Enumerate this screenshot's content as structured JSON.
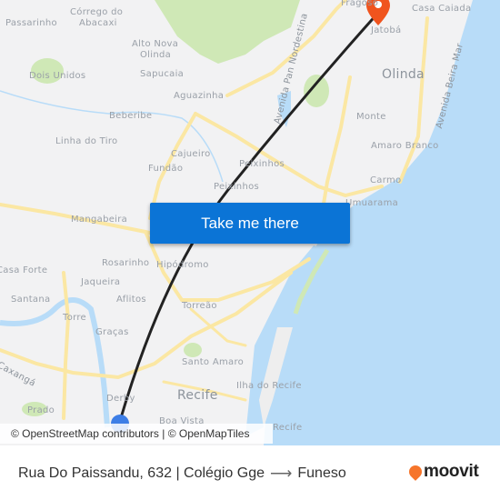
{
  "map": {
    "labels": {
      "passarinho": "Passarinho",
      "corrego": "Córrego do",
      "abacaxi": "Abacaxi",
      "alto_nova": "Alto Nova",
      "olinda_small": "Olinda",
      "dois_unidos": "Dois Unidos",
      "sapucaia": "Sapucaia",
      "aguazinha": "Aguazinha",
      "beberibe": "Beberibe",
      "linha_do_tiro": "Linha do Tiro",
      "cajueiro": "Cajueiro",
      "fundao": "Fundão",
      "peixinhos1": "Peixinhos",
      "peixinhos2": "Peixinhos",
      "fragoso": "Fragoso",
      "casa_caiada": "Casa Caiada",
      "jatoba": "Jatobá",
      "olinda": "Olinda",
      "monte": "Monte",
      "amaro_branco": "Amaro Branco",
      "carmo": "Carmo",
      "umuarama": "Umuarama",
      "av_pan_nordestina": "Avenida Pan Nordestina",
      "av_beira_mar": "Avenida Beira Mar",
      "mangabeira": "Mangabeira",
      "casa_forte": "Casa Forte",
      "rosarinho": "Rosarinho",
      "hipodromo": "Hipódromo",
      "jaqueira": "Jaqueira",
      "santana": "Santana",
      "aflitos": "Aflitos",
      "torreao": "Torreão",
      "torre": "Torre",
      "gracas": "Graças",
      "av_caxanga": "Avenida Caxangá",
      "santo_amaro": "Santo Amaro",
      "recife": "Recife",
      "ilha_do_recife": "Ilha do Recife",
      "derby": "Derby",
      "prado": "Prado",
      "boa_vista": "Boa Vista",
      "recife_antigo": "Recife"
    },
    "cta_label": "Take me there",
    "attribution": "© OpenStreetMap contributors | © OpenMapTiles",
    "colors": {
      "origin": "#3d7ee6",
      "destination": "#f0541e",
      "route_line": "#222222",
      "water": "#b8dcf8",
      "road": "#fbe7a3",
      "park": "#cfe8b6",
      "cta": "#0b74d6"
    }
  },
  "footer": {
    "origin": "Rua Do Paissandu, 632 | Colégio Gge",
    "arrow": "⟶",
    "destination": "Funeso",
    "brand": "moovit"
  }
}
